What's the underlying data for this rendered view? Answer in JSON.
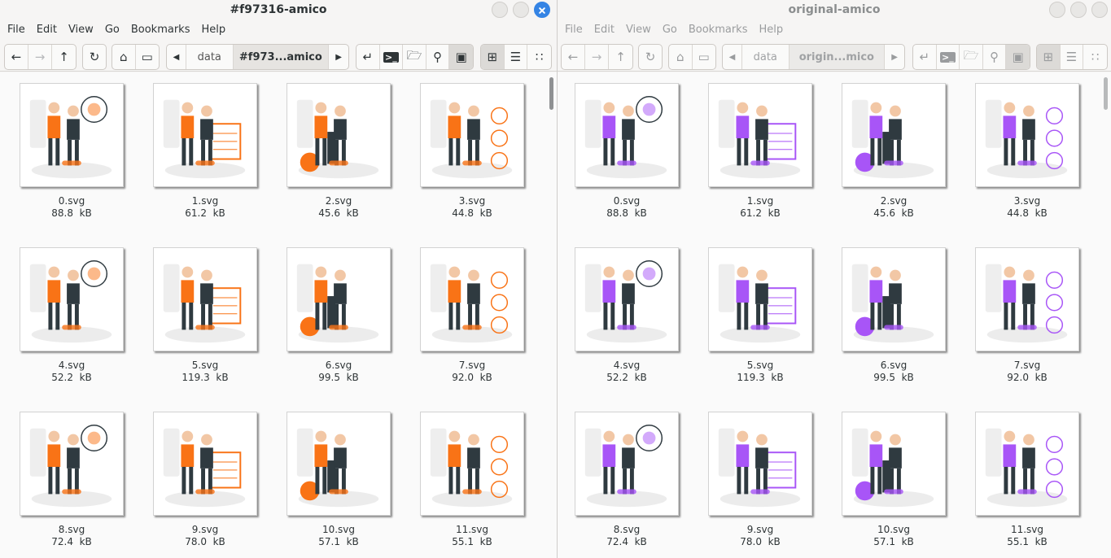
{
  "colors": {
    "left_accent": "#f97316",
    "right_accent": "#a855f7",
    "dark": "#2f3a40",
    "skin": "#f2c7a5"
  },
  "menu": [
    "File",
    "Edit",
    "View",
    "Go",
    "Bookmarks",
    "Help"
  ],
  "left": {
    "title": "#f97316-amico",
    "breadcrumbs": [
      "data",
      "#f973...amico"
    ],
    "files": [
      {
        "name": "0.svg",
        "size": "88.8  kB"
      },
      {
        "name": "1.svg",
        "size": "61.2  kB"
      },
      {
        "name": "2.svg",
        "size": "45.6  kB"
      },
      {
        "name": "3.svg",
        "size": "44.8  kB"
      },
      {
        "name": "4.svg",
        "size": "52.2  kB"
      },
      {
        "name": "5.svg",
        "size": "119.3  kB"
      },
      {
        "name": "6.svg",
        "size": "99.5  kB"
      },
      {
        "name": "7.svg",
        "size": "92.0  kB"
      },
      {
        "name": "8.svg",
        "size": "72.4  kB"
      },
      {
        "name": "9.svg",
        "size": "78.0  kB"
      },
      {
        "name": "10.svg",
        "size": "57.1  kB"
      },
      {
        "name": "11.svg",
        "size": "55.1  kB"
      }
    ]
  },
  "right": {
    "title": "original-amico",
    "breadcrumbs": [
      "data",
      "origin...mico"
    ],
    "files": [
      {
        "name": "0.svg",
        "size": "88.8  kB"
      },
      {
        "name": "1.svg",
        "size": "61.2  kB"
      },
      {
        "name": "2.svg",
        "size": "45.6  kB"
      },
      {
        "name": "3.svg",
        "size": "44.8  kB"
      },
      {
        "name": "4.svg",
        "size": "52.2  kB"
      },
      {
        "name": "5.svg",
        "size": "119.3  kB"
      },
      {
        "name": "6.svg",
        "size": "99.5  kB"
      },
      {
        "name": "7.svg",
        "size": "92.0  kB"
      },
      {
        "name": "8.svg",
        "size": "72.4  kB"
      },
      {
        "name": "9.svg",
        "size": "78.0  kB"
      },
      {
        "name": "10.svg",
        "size": "57.1  kB"
      },
      {
        "name": "11.svg",
        "size": "55.1  kB"
      }
    ]
  },
  "icons": {
    "back": "arrow-left-icon",
    "forward": "arrow-right-icon",
    "up": "arrow-up-icon",
    "reload": "reload-icon",
    "home": "home-icon",
    "computer": "computer-icon",
    "terminal": "terminal-icon",
    "new_folder": "new-folder-icon",
    "search": "search-icon",
    "image": "image-icon",
    "grid": "icon-view-icon",
    "list": "list-view-icon",
    "compact": "compact-view-icon"
  }
}
